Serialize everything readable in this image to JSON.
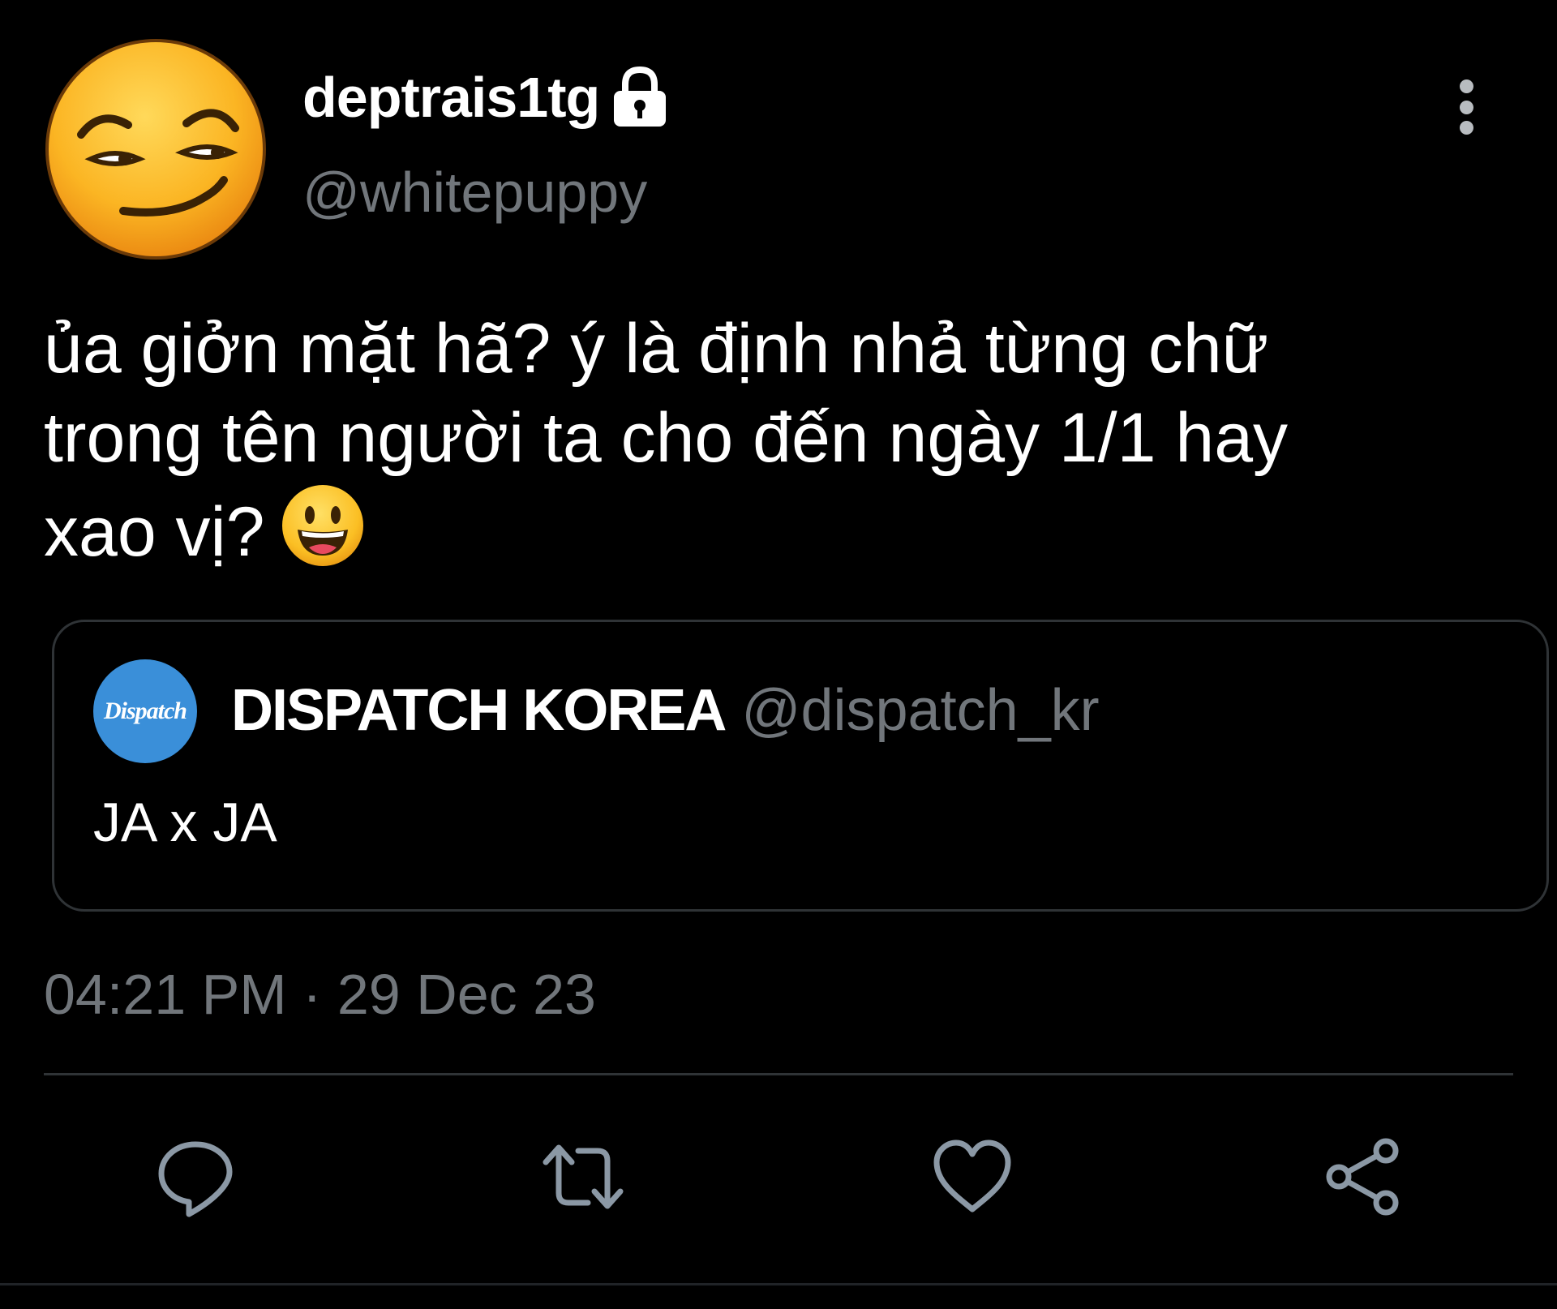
{
  "author": {
    "display_name": "deptrais1tg",
    "handle": "@whitepuppy",
    "avatar_icon": "smirking-face-emoji",
    "protected_icon": "lock-icon"
  },
  "tweet": {
    "lines": [
      "ủa giởn mặt hã? ý là định nhả từng chữ",
      "trong tên người ta cho đến ngày 1/1 hay",
      "xao vị?"
    ],
    "trailing_emoji": "grinning-face-emoji"
  },
  "quoted_tweet": {
    "avatar_logo_text": "Dispatch",
    "name": "DISPATCH KOREA",
    "handle": "@dispatch_kr",
    "text": "JA x JA"
  },
  "timestamp": "04:21 PM · 29 Dec 23",
  "actions": {
    "reply_icon": "reply-icon",
    "retweet_icon": "retweet-icon",
    "like_icon": "heart-icon",
    "share_icon": "share-icon"
  },
  "colors": {
    "background": "#000000",
    "primary_text": "#ffffff",
    "secondary_text": "#71767b",
    "border": "#2f3336",
    "dispatch_blue": "#3a8fd9"
  }
}
